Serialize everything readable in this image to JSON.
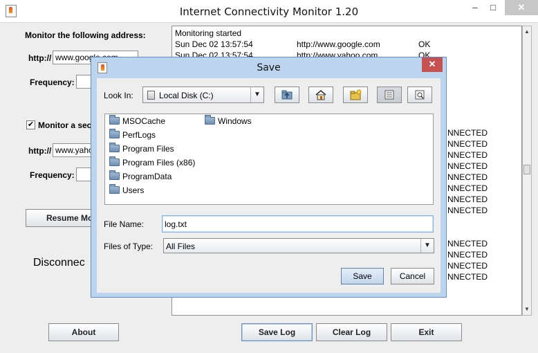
{
  "window": {
    "title": "Internet Connectivity Monitor 1.20",
    "minimize": "–",
    "maximize": "□",
    "close": "✕"
  },
  "left_panel": {
    "monitor_heading": "Monitor the following address:",
    "http_label_1": "http://",
    "address_1": "www.google.com",
    "frequency_label_1": "Frequency:",
    "frequency_1": "",
    "secondary_checkbox_checked": true,
    "secondary_checkbox_mark": "✔",
    "secondary_label": "Monitor a sec",
    "http_label_2": "http://",
    "address_2": "www.yaho",
    "frequency_label_2": "Frequency:",
    "frequency_2": "",
    "resume_button": "Resume Mo",
    "status_text": "Disconnec"
  },
  "log": {
    "lines": [
      {
        "text": "Monitoring started",
        "url": "",
        "status": ""
      },
      {
        "text": "Sun Dec 02 13:57:54",
        "url": "http://www.google.com",
        "status": "OK"
      },
      {
        "text": "Sun Dec 02 13:57:54",
        "url": "http://www.yahoo.com",
        "status": "OK"
      }
    ],
    "status_lines_group1": [
      "NNECTED",
      "NNECTED",
      "NNECTED",
      "NNECTED",
      "NNECTED",
      "NNECTED",
      "NNECTED",
      "NNECTED"
    ],
    "status_lines_group2": [
      "NNECTED",
      "NNECTED",
      "NNECTED",
      "NNECTED"
    ]
  },
  "bottom_buttons": {
    "about": "About",
    "save_log": "Save Log",
    "clear_log": "Clear Log",
    "exit": "Exit"
  },
  "dialog": {
    "title": "Save",
    "close": "✕",
    "look_in_label": "Look In:",
    "look_in_value": "Local Disk (C:)",
    "toolbar_icons": [
      "up-folder-icon",
      "home-icon",
      "new-folder-icon",
      "list-view-icon",
      "details-view-icon"
    ],
    "folders_col1": [
      "MSOCache",
      "PerfLogs",
      "Program Files",
      "Program Files (x86)",
      "ProgramData",
      "Users"
    ],
    "folders_col2": [
      "Windows"
    ],
    "file_name_label": "File Name:",
    "file_name_value": "log.txt",
    "files_of_type_label": "Files of Type:",
    "files_of_type_value": "All Files",
    "save_button": "Save",
    "cancel_button": "Cancel"
  },
  "colors": {
    "dialog_frame": "#bcd4ee",
    "dialog_close": "#c75050",
    "window_bg": "#eeeeee"
  }
}
